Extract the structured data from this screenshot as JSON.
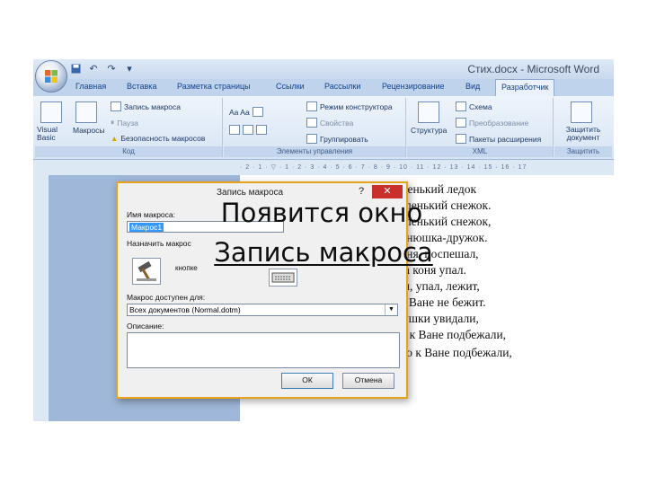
{
  "window": {
    "title": "Стих.docx - Microsoft Word",
    "quick_access": [
      "save-icon",
      "undo-icon",
      "redo-icon",
      "customize-icon"
    ]
  },
  "tabs": [
    {
      "label": "Главная"
    },
    {
      "label": "Вставка"
    },
    {
      "label": "Разметка страницы"
    },
    {
      "label": "Ссылки"
    },
    {
      "label": "Рассылки"
    },
    {
      "label": "Рецензирование"
    },
    {
      "label": "Вид"
    },
    {
      "label": "Разработчик",
      "active": true
    }
  ],
  "ribbon": {
    "code": {
      "visual_basic": "Visual Basic",
      "macros": "Макросы",
      "record_macro": "Запись макроса",
      "pause": "Пауза",
      "macro_security": "Безопасность макросов",
      "label": "Код"
    },
    "controls": {
      "design_mode": "Режим конструктора",
      "properties": "Свойства",
      "group": "Группировать",
      "label": "Элементы управления"
    },
    "xml": {
      "structure": "Структура",
      "schema": "Схема",
      "transform": "Преобразование",
      "expansion_packs": "Пакеты расширения",
      "label": "XML"
    },
    "protect": {
      "protect_document": "Защитить документ",
      "label": "Защитить"
    }
  },
  "document": {
    "lines": [
      "...беленький ледок",
      "...ал беленький снежок.",
      "...ал беленький снежок,",
      "...л Ванюшка-дружок.",
      "...л Ваня, поспешал,",
      "...рона коня упал.",
      "...упал, упал, лежит,",
      "...то к Ване не бежит.",
      "...девушки увидали,",
      "...Скоро к Ване подбежали,",
      "Строка 11. Скоро к Ване подбежали,"
    ]
  },
  "dialog": {
    "title": "Запись макроса",
    "help": "?",
    "close": "✕",
    "macro_name_label": "Имя макроса:",
    "macro_name_value": "Макрос1",
    "assign_label": "Назначить макрос",
    "button_label": "кнопке",
    "available_label": "Макрос доступен для:",
    "available_value": "Всех документов (Normal.dotm)",
    "description_label": "Описание:",
    "ok": "ОК",
    "cancel": "Отмена"
  },
  "caption": {
    "line1": "Появится окно",
    "line2": "Запись макроса"
  },
  "colors": {
    "dialog_border": "#e8a21a",
    "close_button": "#c9302c",
    "ribbon_text": "#15428b"
  }
}
